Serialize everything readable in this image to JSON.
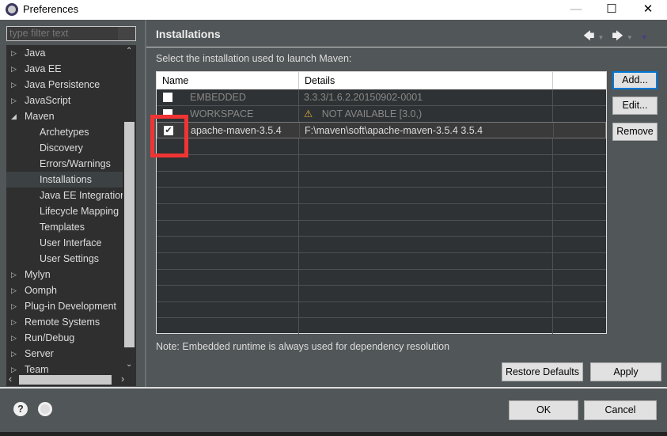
{
  "window": {
    "title": "Preferences",
    "minimize": "—",
    "maximize": "☐",
    "close": "✕"
  },
  "sidebar": {
    "filter_placeholder": "type filter text",
    "items": [
      {
        "label": "Java",
        "level": 0,
        "expanded": false
      },
      {
        "label": "Java EE",
        "level": 0,
        "expanded": false
      },
      {
        "label": "Java Persistence",
        "level": 0,
        "expanded": false
      },
      {
        "label": "JavaScript",
        "level": 0,
        "expanded": false
      },
      {
        "label": "Maven",
        "level": 0,
        "expanded": true
      },
      {
        "label": "Archetypes",
        "level": 1
      },
      {
        "label": "Discovery",
        "level": 1
      },
      {
        "label": "Errors/Warnings",
        "level": 1
      },
      {
        "label": "Installations",
        "level": 1,
        "selected": true
      },
      {
        "label": "Java EE Integration",
        "level": 1
      },
      {
        "label": "Lifecycle Mapping",
        "level": 1
      },
      {
        "label": "Templates",
        "level": 1
      },
      {
        "label": "User Interface",
        "level": 1
      },
      {
        "label": "User Settings",
        "level": 1
      },
      {
        "label": "Mylyn",
        "level": 0,
        "expanded": false
      },
      {
        "label": "Oomph",
        "level": 0,
        "expanded": false
      },
      {
        "label": "Plug-in Development",
        "level": 0,
        "expanded": false
      },
      {
        "label": "Remote Systems",
        "level": 0,
        "expanded": false
      },
      {
        "label": "Run/Debug",
        "level": 0,
        "expanded": false
      },
      {
        "label": "Server",
        "level": 0,
        "expanded": false
      },
      {
        "label": "Team",
        "level": 0,
        "expanded": false
      }
    ]
  },
  "page": {
    "title": "Installations",
    "prompt": "Select the installation used to launch Maven:",
    "table": {
      "columns": [
        "Name",
        "Details",
        ""
      ],
      "rows": [
        {
          "checked": false,
          "name": "EMBEDDED",
          "details": "3.3.3/1.6.2.20150902-0001",
          "dimmed": true,
          "warning": false
        },
        {
          "checked": false,
          "name": "WORKSPACE",
          "details": "NOT AVAILABLE [3.0,)",
          "dimmed": true,
          "warning": true
        },
        {
          "checked": true,
          "name": "apache-maven-3.5.4",
          "details": "F:\\maven\\soft\\apache-maven-3.5.4 3.5.4",
          "dimmed": false,
          "warning": false
        }
      ]
    },
    "buttons": {
      "add": "Add...",
      "edit": "Edit...",
      "remove": "Remove"
    },
    "note_label": "Note:",
    "note": "Embedded runtime is always used for dependency resolution",
    "restore_defaults": "Restore Defaults",
    "apply": "Apply"
  },
  "footer": {
    "ok": "OK",
    "cancel": "Cancel"
  },
  "colors": {
    "background": "#515658",
    "tree": "#2f2f2f",
    "highlight": "#f03434",
    "focus": "#0078d7"
  }
}
